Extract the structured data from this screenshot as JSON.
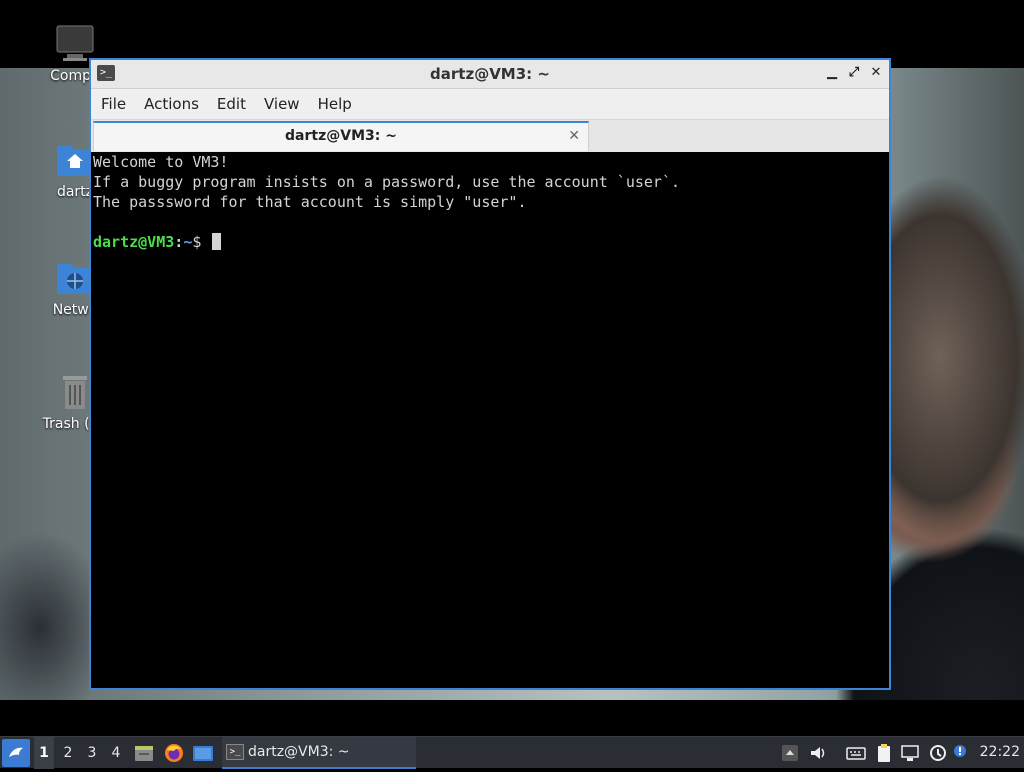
{
  "desktop": {
    "icons": [
      {
        "label": "Compu",
        "icon": "computer-icon"
      },
      {
        "label": "dartz",
        "icon": "home-folder-icon"
      },
      {
        "label": "Netwo",
        "icon": "network-folder-icon"
      },
      {
        "label": "Trash (En",
        "icon": "trash-icon"
      }
    ]
  },
  "window": {
    "title": "dartz@VM3: ~",
    "icon": "terminal-icon",
    "controls": {
      "minimize": "▁",
      "maximize": "⤢",
      "close": "✕"
    }
  },
  "menubar": {
    "items": [
      "File",
      "Actions",
      "Edit",
      "View",
      "Help"
    ]
  },
  "tabs": [
    {
      "label": "dartz@VM3: ~",
      "close": "✕"
    }
  ],
  "terminal": {
    "lines": [
      "Welcome to VM3!",
      "If a buggy program insists on a password, use the account `user`.",
      "The passsword for that account is simply \"user\".",
      ""
    ],
    "prompt": {
      "user_host": "dartz@VM3",
      "sep": ":",
      "path": "~",
      "symbol": "$ "
    }
  },
  "taskbar": {
    "start_icon": "start-menu-icon",
    "workspaces": [
      "1",
      "2",
      "3",
      "4"
    ],
    "launchers": [
      "files-icon",
      "firefox-icon",
      "show-desktop-icon"
    ],
    "task": {
      "label": "dartz@VM3: ~",
      "icon": "terminal-icon"
    },
    "tray": [
      "show-hidden-icon",
      "volume-icon",
      "keyboard-icon",
      "clipboard-icon",
      "network-icon",
      "update-icon",
      "notification-icon"
    ],
    "clock": "22:22"
  },
  "colors": {
    "accent": "#3d84d6",
    "prompt_user": "#4ddc4d",
    "prompt_path": "#5aa0e8",
    "terminal_bg": "#000000",
    "terminal_fg": "#d4d4d4"
  }
}
